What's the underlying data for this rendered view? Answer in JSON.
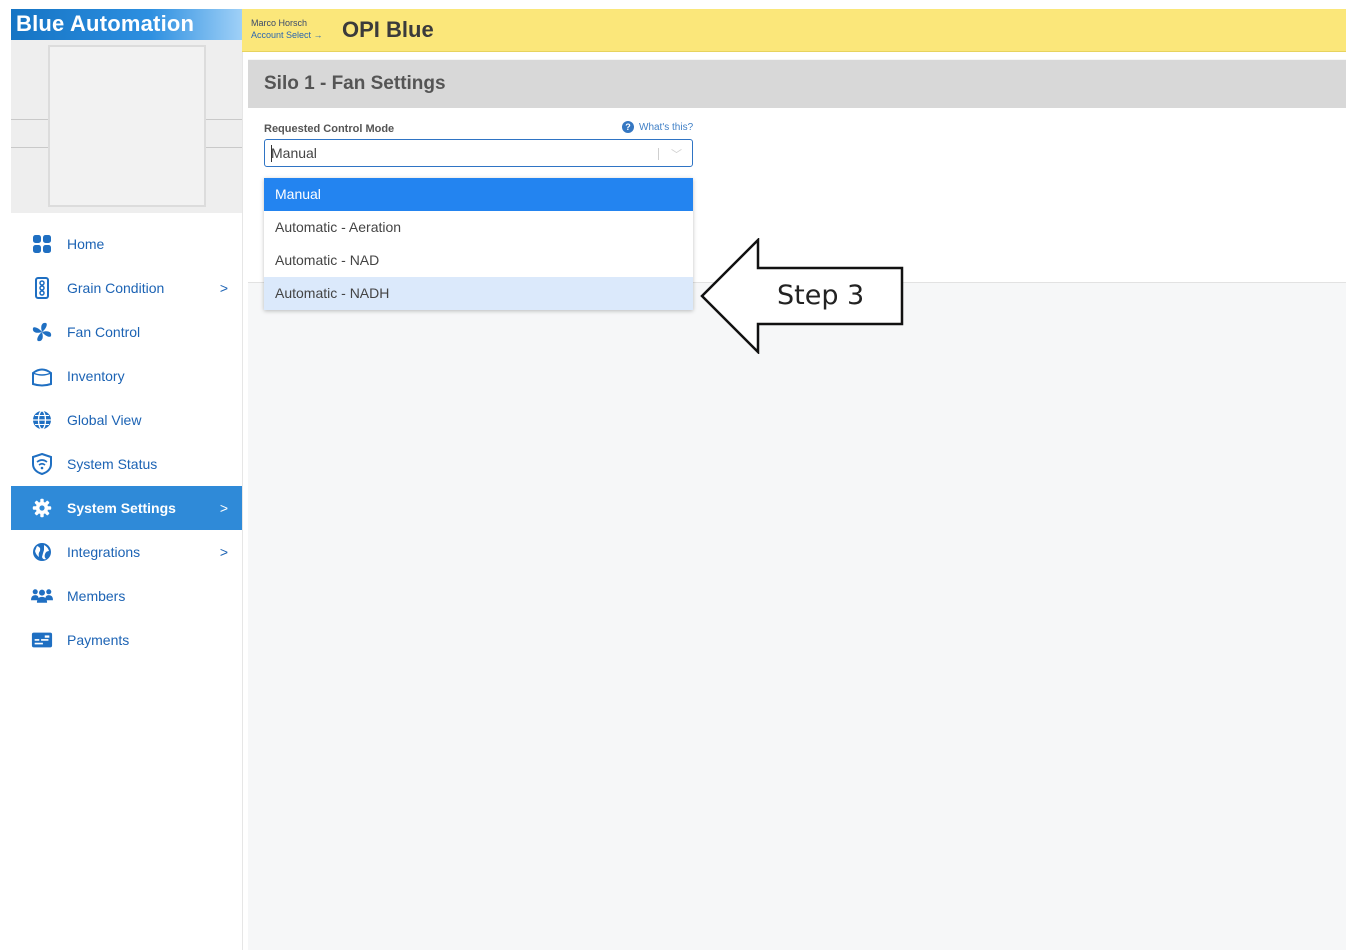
{
  "brand": "Blue Automation",
  "header": {
    "account_name": "Marco Horsch",
    "account_select": "Account Select →",
    "title": "OPI Blue"
  },
  "sidebar": {
    "items": [
      {
        "label": "Home",
        "icon": "grid-icon",
        "chevron": false
      },
      {
        "label": "Grain Condition",
        "icon": "traffic-light-icon",
        "chevron": true
      },
      {
        "label": "Fan Control",
        "icon": "fan-icon",
        "chevron": false
      },
      {
        "label": "Inventory",
        "icon": "bin-icon",
        "chevron": false
      },
      {
        "label": "Global View",
        "icon": "globe-icon",
        "chevron": false
      },
      {
        "label": "System Status",
        "icon": "shield-wifi-icon",
        "chevron": false
      },
      {
        "label": "System Settings",
        "icon": "gear-icon",
        "chevron": true,
        "active": true
      },
      {
        "label": "Integrations",
        "icon": "earth-icon",
        "chevron": true
      },
      {
        "label": "Members",
        "icon": "users-icon",
        "chevron": false
      },
      {
        "label": "Payments",
        "icon": "card-icon",
        "chevron": false
      }
    ],
    "chevron_glyph": ">"
  },
  "panel": {
    "title": "Silo 1 - Fan Settings",
    "field_label": "Requested Control Mode",
    "help_link": "What's this?",
    "help_icon_glyph": "?",
    "select_value": "Manual",
    "arrow_glyph": "﹀"
  },
  "dropdown": {
    "options": [
      "Manual",
      "Automatic - Aeration",
      "Automatic - NAD",
      "Automatic - NADH"
    ],
    "selected_index": 0,
    "hover_index": 3
  },
  "annotation": {
    "text": "Step 3"
  },
  "colors": {
    "header_bg": "#fbe77a",
    "brand_blue": "#1574c4",
    "nav_active": "#2f8ad8",
    "option_selected": "#2384f0",
    "option_hover": "#dbe9fb",
    "nav_text": "#1c63b4"
  }
}
